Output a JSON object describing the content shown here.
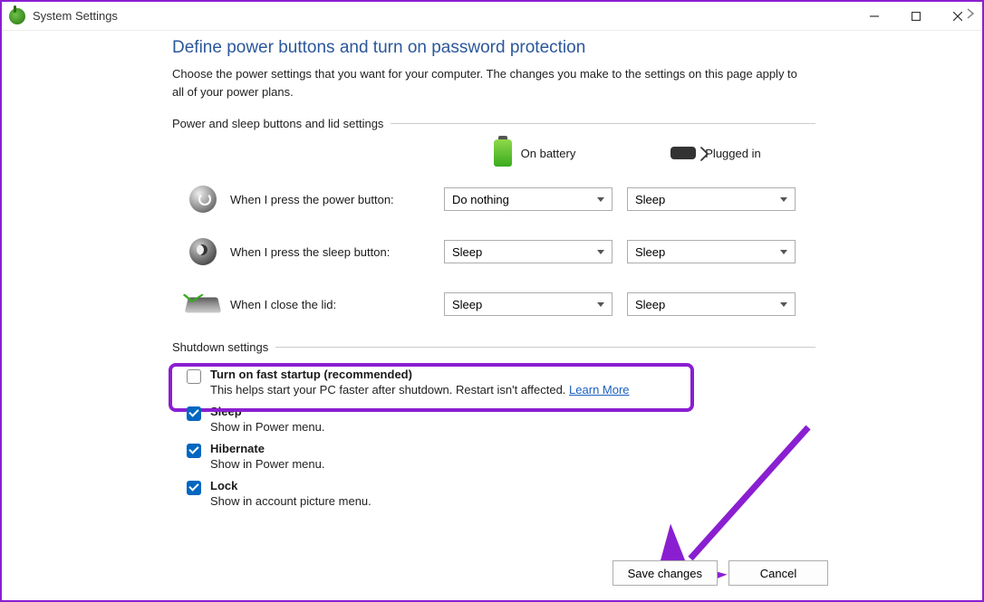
{
  "window": {
    "title": "System Settings"
  },
  "page": {
    "heading": "Define power buttons and turn on password protection",
    "description": "Choose the power settings that you want for your computer. The changes you make to the settings on this page apply to all of your power plans."
  },
  "section1": {
    "header": "Power and sleep buttons and lid settings",
    "mode_battery": "On battery",
    "mode_plugged": "Plugged in",
    "rows": [
      {
        "label": "When I press the power button:",
        "battery": "Do nothing",
        "plugged": "Sleep"
      },
      {
        "label": "When I press the sleep button:",
        "battery": "Sleep",
        "plugged": "Sleep"
      },
      {
        "label": "When I close the lid:",
        "battery": "Sleep",
        "plugged": "Sleep"
      }
    ]
  },
  "section2": {
    "header": "Shutdown settings",
    "items": [
      {
        "checked": false,
        "title": "Turn on fast startup (recommended)",
        "desc": "This helps start your PC faster after shutdown. Restart isn't affected.",
        "learn_more": "Learn More"
      },
      {
        "checked": true,
        "title": "Sleep",
        "desc": "Show in Power menu."
      },
      {
        "checked": true,
        "title": "Hibernate",
        "desc": "Show in Power menu."
      },
      {
        "checked": true,
        "title": "Lock",
        "desc": "Show in account picture menu."
      }
    ]
  },
  "buttons": {
    "save": "Save changes",
    "cancel": "Cancel"
  }
}
